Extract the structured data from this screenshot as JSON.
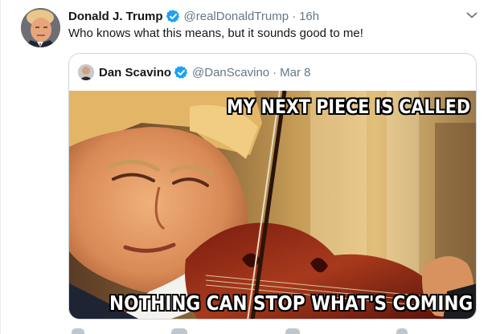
{
  "tweet": {
    "author_name": "Donald J. Trump",
    "handle": "@realDonaldTrump",
    "separator": "·",
    "time": "16h",
    "text": "Who knows what this means, but it sounds good to me!",
    "verified_icon": "verified-badge-icon",
    "menu_icon": "chevron-down-icon"
  },
  "quoted_tweet": {
    "author_name": "Dan Scavino",
    "handle": "@DanScavino",
    "separator": "·",
    "date": "Mar 8",
    "verified_icon": "verified-badge-icon",
    "image": {
      "top_caption": "MY NEXT PIECE IS CALLED",
      "bottom_caption": "NOTHING CAN STOP WHAT'S COMING"
    }
  },
  "colors": {
    "text": "#14171a",
    "muted": "#657786",
    "verified": "#1da1f2",
    "border": "#ccd6dd"
  }
}
